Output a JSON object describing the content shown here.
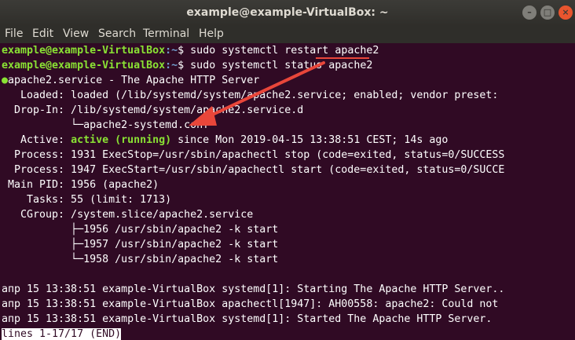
{
  "window": {
    "title": "example@example-VirtualBox: ~",
    "controls": {
      "minimize": "–",
      "maximize": "□",
      "close": "×"
    }
  },
  "menu": {
    "items": [
      "File",
      "Edit",
      "View",
      "Search",
      "Terminal",
      "Help"
    ]
  },
  "terminal": {
    "prompts": [
      {
        "user": "example@example-VirtualBox",
        "path": ":~",
        "sign": "$",
        "command_pre": " sudo systemctl ",
        "command_highlight": "restart",
        "command_post": " apache2"
      },
      {
        "user": "example@example-VirtualBox",
        "path": ":~",
        "sign": "$",
        "command": " sudo systemctl status apache2"
      }
    ],
    "service_header": "apache2.service - The Apache HTTP Server",
    "loaded": "   Loaded: loaded (/lib/systemd/system/apache2.service; enabled; vendor preset:",
    "dropin": "  Drop-In: /lib/systemd/system/apache2.service.d",
    "dropin_conf": "           └─apache2-systemd.conf",
    "active_label": "   Active: ",
    "active_status": "active (running)",
    "active_since": " since Mon 2019-04-15 13:38:51 CEST; 14s ago",
    "process1": "  Process: 1931 ExecStop=/usr/sbin/apachectl stop (code=exited, status=0/SUCCESS",
    "process2": "  Process: 1947 ExecStart=/usr/sbin/apachectl start (code=exited, status=0/SUCCE",
    "main_pid": " Main PID: 1956 (apache2)",
    "tasks": "    Tasks: 55 (limit: 1713)",
    "cgroup": "   CGroup: /system.slice/apache2.service",
    "cgroup_children": [
      "           ├─1956 /usr/sbin/apache2 -k start",
      "           ├─1957 /usr/sbin/apache2 -k start",
      "           └─1958 /usr/sbin/apache2 -k start"
    ],
    "log_lines": [
      "апр 15 13:38:51 example-VirtualBox systemd[1]: Starting The Apache HTTP Server..",
      "апр 15 13:38:51 example-VirtualBox apachectl[1947]: AH00558: apache2: Could not",
      "апр 15 13:38:51 example-VirtualBox systemd[1]: Started The Apache HTTP Server."
    ],
    "pager_status": "lines 1-17/17 (END)"
  },
  "annotation": {
    "color": "#e9463a",
    "arrow_icon": "arrow-annotation-icon"
  }
}
